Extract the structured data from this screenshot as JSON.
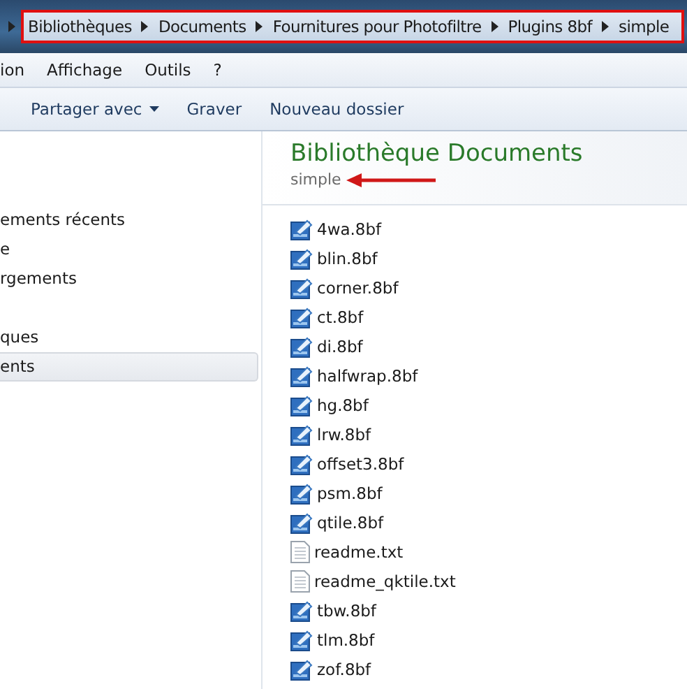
{
  "breadcrumb": [
    "Bibliothèques",
    "Documents",
    "Fournitures pour Photofiltre",
    "Plugins 8bf",
    "simple"
  ],
  "menu": [
    "ion",
    "Affichage",
    "Outils",
    "?"
  ],
  "toolbar": [
    {
      "label": "Partager avec",
      "dropdown": true
    },
    {
      "label": "Graver",
      "dropdown": false
    },
    {
      "label": "Nouveau dossier",
      "dropdown": false
    }
  ],
  "sidebar": {
    "groups": [
      [
        {
          "label": "ements récents",
          "selected": false
        },
        {
          "label": "e",
          "selected": false
        },
        {
          "label": "rgements",
          "selected": false
        }
      ],
      [
        {
          "label": "ques",
          "selected": false
        },
        {
          "label": "ents",
          "selected": true
        }
      ]
    ]
  },
  "library": {
    "title": "Bibliothèque Documents",
    "subtitle": "simple"
  },
  "files": [
    {
      "name": "4wa.8bf",
      "kind": "plugin"
    },
    {
      "name": "blin.8bf",
      "kind": "plugin"
    },
    {
      "name": "corner.8bf",
      "kind": "plugin"
    },
    {
      "name": "ct.8bf",
      "kind": "plugin"
    },
    {
      "name": "di.8bf",
      "kind": "plugin"
    },
    {
      "name": "halfwrap.8bf",
      "kind": "plugin"
    },
    {
      "name": "hg.8bf",
      "kind": "plugin"
    },
    {
      "name": "lrw.8bf",
      "kind": "plugin"
    },
    {
      "name": "offset3.8bf",
      "kind": "plugin"
    },
    {
      "name": "psm.8bf",
      "kind": "plugin"
    },
    {
      "name": "qtile.8bf",
      "kind": "plugin"
    },
    {
      "name": "readme.txt",
      "kind": "text"
    },
    {
      "name": "readme_qktile.txt",
      "kind": "text"
    },
    {
      "name": "tbw.8bf",
      "kind": "plugin"
    },
    {
      "name": "tlm.8bf",
      "kind": "plugin"
    },
    {
      "name": "zof.8bf",
      "kind": "plugin"
    }
  ]
}
